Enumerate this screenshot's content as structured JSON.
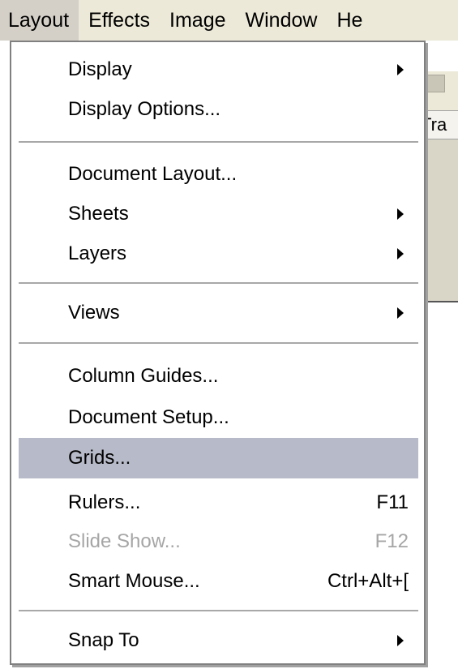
{
  "menubar": {
    "items": [
      "Layout",
      "Effects",
      "Image",
      "Window",
      "He"
    ]
  },
  "background": {
    "tab_fragment": "Tra"
  },
  "menu": {
    "items": [
      {
        "label": "Display",
        "shortcut": "",
        "submenu": true
      },
      {
        "label": "Display Options...",
        "shortcut": "",
        "submenu": false
      },
      {
        "label": "Document Layout...",
        "shortcut": "",
        "submenu": false
      },
      {
        "label": "Sheets",
        "shortcut": "",
        "submenu": true
      },
      {
        "label": "Layers",
        "shortcut": "",
        "submenu": true
      },
      {
        "label": "Views",
        "shortcut": "",
        "submenu": true
      },
      {
        "label": "Column Guides...",
        "shortcut": "",
        "submenu": false
      },
      {
        "label": "Document Setup...",
        "shortcut": "",
        "submenu": false
      },
      {
        "label": "Grids...",
        "shortcut": "",
        "submenu": false,
        "highlighted": true
      },
      {
        "label": "Rulers...",
        "shortcut": "F11",
        "submenu": false
      },
      {
        "label": "Slide Show...",
        "shortcut": "F12",
        "submenu": false,
        "disabled": true
      },
      {
        "label": "Smart Mouse...",
        "shortcut": "Ctrl+Alt+[",
        "submenu": false
      },
      {
        "label": "Snap To",
        "shortcut": "",
        "submenu": true
      }
    ]
  },
  "colors": {
    "menubar_bg": "#ece9d8",
    "highlight": "#b7bac8",
    "disabled_text": "#a6a6a6",
    "separator": "#a8a8a8"
  }
}
